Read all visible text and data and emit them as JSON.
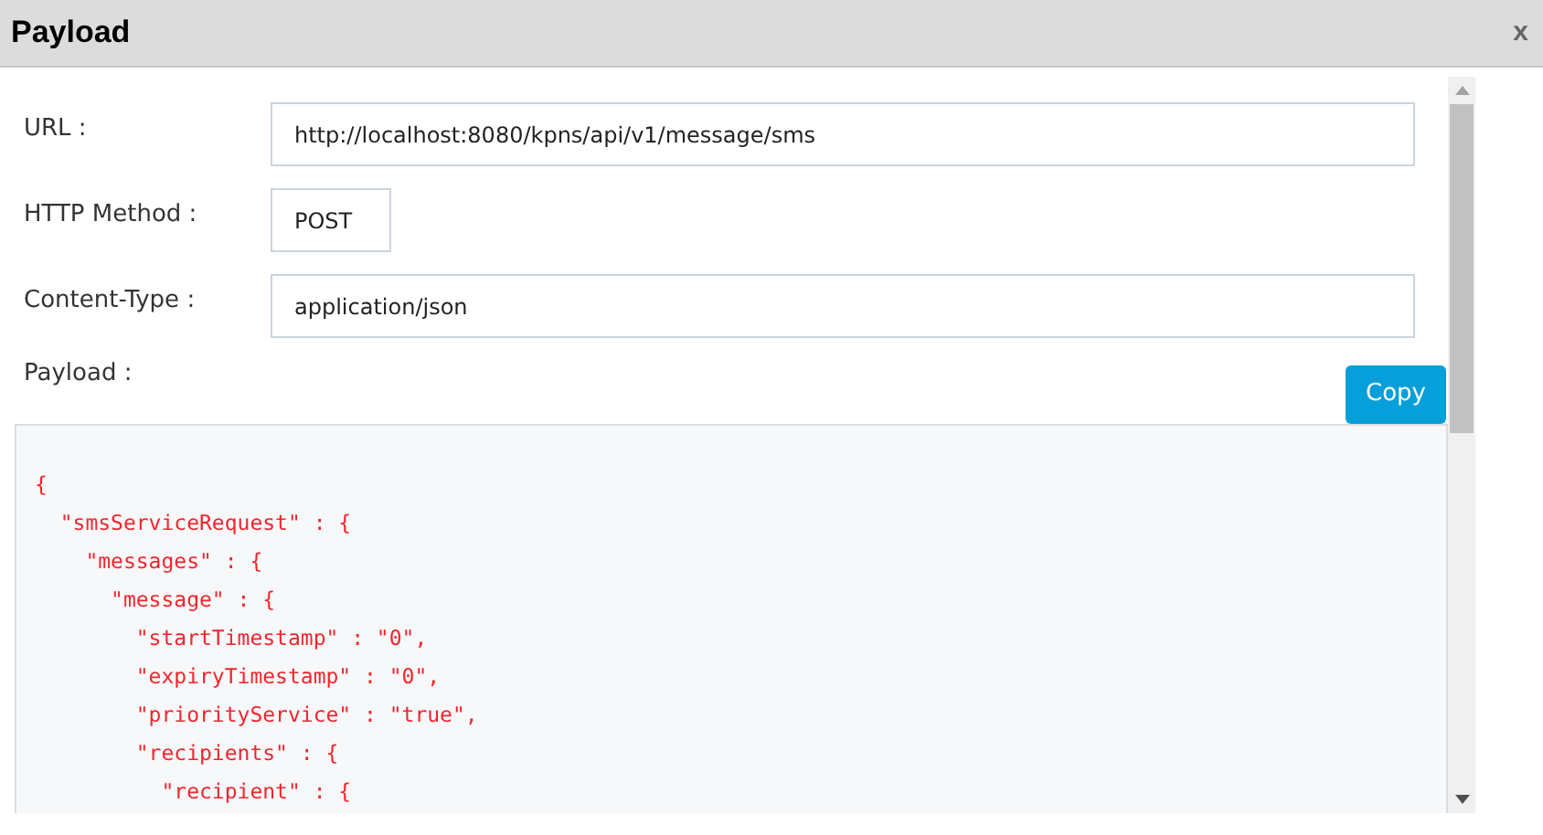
{
  "dialog": {
    "title": "Payload",
    "close": "x"
  },
  "fields": [
    {
      "label": "URL :",
      "value": "http://localhost:8080/kpns/api/v1/message/sms",
      "kind": "wide"
    },
    {
      "label": "HTTP Method :",
      "value": "POST",
      "kind": "narrow"
    },
    {
      "label": "Content-Type :",
      "value": "application/json",
      "kind": "wide"
    }
  ],
  "payload": {
    "label": "Payload :",
    "copy_button": "Copy",
    "code_lines": [
      "{",
      "  \"smsServiceRequest\" : {",
      "    \"messages\" : {",
      "      \"message\" : {",
      "        \"startTimestamp\" : \"0\",",
      "        \"expiryTimestamp\" : \"0\",",
      "        \"priorityService\" : \"true\",",
      "        \"recipients\" : {",
      "          \"recipient\" : {"
    ]
  }
}
